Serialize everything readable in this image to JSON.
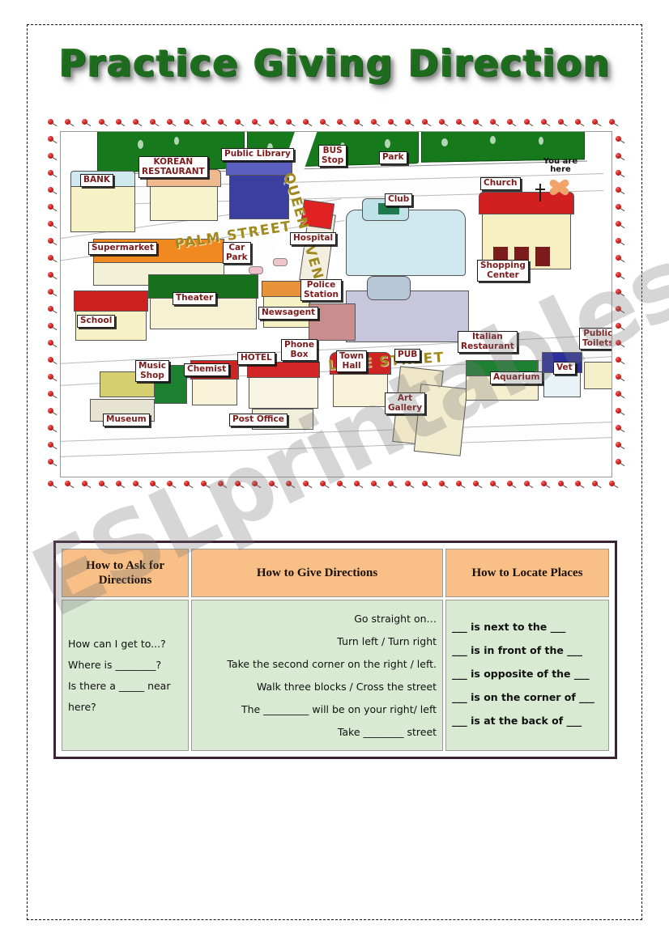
{
  "worksheet": {
    "title": "Practice Giving Direction",
    "watermark": "ESLprintables.com"
  },
  "map": {
    "streets": [
      {
        "name": "PALM STREET"
      },
      {
        "name": "QUEEN AVENUE"
      },
      {
        "name": "LANE STREET"
      }
    ],
    "marker": {
      "label": "You are\nhere",
      "icon": "x-marker"
    },
    "places": [
      {
        "label": "BANK"
      },
      {
        "label": "KOREAN\nRESTAURANT"
      },
      {
        "label": "Public Library"
      },
      {
        "label": "BUS\nStop"
      },
      {
        "label": "Park"
      },
      {
        "label": "Church"
      },
      {
        "label": "Club"
      },
      {
        "label": "Supermarket"
      },
      {
        "label": "Car\nPark"
      },
      {
        "label": "Hospital"
      },
      {
        "label": "Police\nStation"
      },
      {
        "label": "Shopping\nCenter"
      },
      {
        "label": "Theater"
      },
      {
        "label": "School"
      },
      {
        "label": "Newsagent"
      },
      {
        "label": "Public\nToilets"
      },
      {
        "label": "Music\nShop"
      },
      {
        "label": "Chemist"
      },
      {
        "label": "HOTEL"
      },
      {
        "label": "Phone\nBox"
      },
      {
        "label": "Town\nHall"
      },
      {
        "label": "PUB"
      },
      {
        "label": "Italian\nRestaurant"
      },
      {
        "label": "Vet"
      },
      {
        "label": "Aquarium"
      },
      {
        "label": "Museum"
      },
      {
        "label": "Post Office"
      },
      {
        "label": "Art\nGallery"
      }
    ]
  },
  "table": {
    "headers": [
      "How to Ask for Directions",
      "How to Give Directions",
      "How to Locate Places"
    ],
    "ask_for_directions": [
      "How can I get to...?",
      "Where is ________?",
      "Is there a _____ near here?"
    ],
    "give_directions": [
      "Go straight on…",
      "Turn left / Turn right",
      "Take the second corner on the right / left.",
      "Walk three blocks   /   Cross the street",
      "The _________ will be on your right/ left",
      "Take ________ street"
    ],
    "locate_places": [
      "___ is next to the ___",
      "___ is in front of the ___",
      "___ is opposite of the ___",
      "___ is on the corner of ___",
      "___ is at the back of ___"
    ]
  },
  "colors": {
    "title_green": "#2f8f2f",
    "header_peach": "#f8bf86",
    "cell_green": "#d9ead3",
    "table_border": "#3b2235",
    "label_text": "#7c1b1b",
    "street_text": "#a08a20",
    "berry_red": "#d52222",
    "park_green": "#167a1c"
  }
}
